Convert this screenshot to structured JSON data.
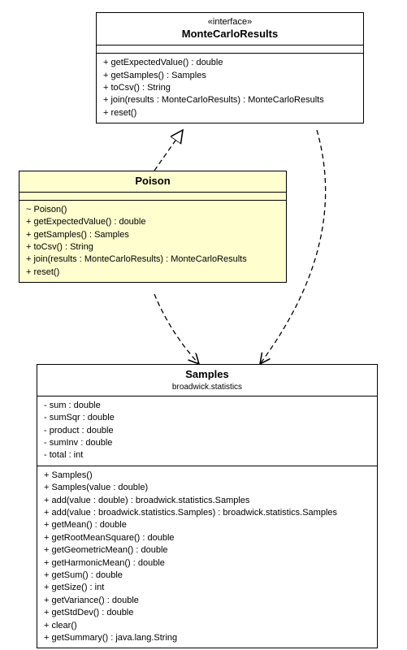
{
  "interface": {
    "stereotype": "«interface»",
    "name": "MonteCarloResults",
    "ops": [
      "+ getExpectedValue() : double",
      "+ getSamples() : Samples",
      "+ toCsv() : String",
      "+ join(results : MonteCarloResults) : MonteCarloResults",
      "+ reset()"
    ]
  },
  "poison": {
    "name": "Poison",
    "ops": [
      "~ Poison()",
      "+ getExpectedValue() : double",
      "+ getSamples() : Samples",
      "+ toCsv() : String",
      "+ join(results : MonteCarloResults) : MonteCarloResults",
      "+ reset()"
    ]
  },
  "samples": {
    "name": "Samples",
    "package": "broadwick.statistics",
    "attrs": [
      "- sum : double",
      "- sumSqr : double",
      "- product : double",
      "- sumInv : double",
      "- total : int"
    ],
    "ops": [
      "+ Samples()",
      "+ Samples(value : double)",
      "+ add(value : double) : broadwick.statistics.Samples",
      "+ add(value : broadwick.statistics.Samples) : broadwick.statistics.Samples",
      "+ getMean() : double",
      "+ getRootMeanSquare() : double",
      "+ getGeometricMean() : double",
      "+ getHarmonicMean() : double",
      "+ getSum() : double",
      "+ getSize() : int",
      "+ getVariance() : double",
      "+ getStdDev() : double",
      "+ clear()",
      "+ getSummary() : java.lang.String"
    ]
  }
}
